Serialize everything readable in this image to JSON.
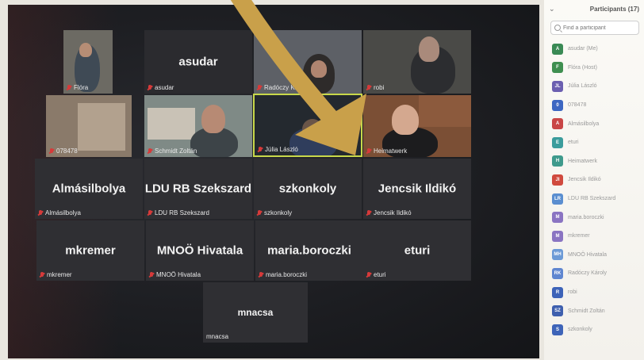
{
  "panel": {
    "title": "Participants (17)",
    "search_placeholder": "Find a participant",
    "participants": [
      {
        "initials": "A",
        "name": "asudar (Me)",
        "color": "#3a8a55"
      },
      {
        "initials": "F",
        "name": "Flóra (Host)",
        "color": "#3f8f50"
      },
      {
        "initials": "JL",
        "name": "Júlia László",
        "color": "#6b5fb0"
      },
      {
        "initials": "0",
        "name": "078478",
        "color": "#3d67c2"
      },
      {
        "initials": "A",
        "name": "Almásilbolya",
        "color": "#c94646"
      },
      {
        "initials": "E",
        "name": "eturi",
        "color": "#3b9c9c"
      },
      {
        "initials": "H",
        "name": "Heimatwerk",
        "color": "#3f9a8c"
      },
      {
        "initials": "JI",
        "name": "Jencsik Ildikó",
        "color": "#d04a3e"
      },
      {
        "initials": "LR",
        "name": "LDU RB Szekszard",
        "color": "#5a8ed0"
      },
      {
        "initials": "M",
        "name": "maria.boroczki",
        "color": "#8a74c2"
      },
      {
        "initials": "M",
        "name": "mkremer",
        "color": "#8a74c2"
      },
      {
        "initials": "MH",
        "name": "MNOÖ Hivatala",
        "color": "#6c9ad6"
      },
      {
        "initials": "RK",
        "name": "Radóczy Károly",
        "color": "#5f86d0"
      },
      {
        "initials": "R",
        "name": "robi",
        "color": "#3d63b8"
      },
      {
        "initials": "SZ",
        "name": "Schmidt Zoltán",
        "color": "#3e5fae"
      },
      {
        "initials": "S",
        "name": "szkonkoly",
        "color": "#3e64b8"
      }
    ]
  },
  "tiles": {
    "flora": {
      "label": "Flóra"
    },
    "asudar": {
      "label": "asudar",
      "big": "asudar"
    },
    "radoczy": {
      "label": "Radóczy Károly"
    },
    "robi": {
      "label": "robi"
    },
    "t078478": {
      "label": "078478"
    },
    "schmidt": {
      "label": "Schmidt Zoltán"
    },
    "julia": {
      "label": "Júlia László"
    },
    "heimatwerk": {
      "label": "Heimatwerk"
    },
    "almasilbolya": {
      "label": "Almásilbolya",
      "big": "Almásilbolya"
    },
    "ldu": {
      "label": "LDU RB Szekszard",
      "big": "LDU RB Szekszard"
    },
    "szkonkoly": {
      "label": "szkonkoly",
      "big": "szkonkoly"
    },
    "jencsik": {
      "label": "Jencsik Ildikó",
      "big": "Jencsik Ildikó"
    },
    "mkremer": {
      "label": "mkremer",
      "big": "mkremer"
    },
    "mnoo": {
      "label": "MNOÖ Hivatala",
      "big": "MNOÖ Hivatala"
    },
    "maria": {
      "label": "maria.boroczki",
      "big": "maria.boroczki"
    },
    "eturi": {
      "label": "eturi",
      "big": "eturi"
    },
    "mnacsa": {
      "label": "mnacsa",
      "big": "mnacsa"
    }
  },
  "colors": {
    "arrow": "#c9a04a",
    "highlight": "#c8d84a",
    "muted_mic": "#d63a3a"
  }
}
